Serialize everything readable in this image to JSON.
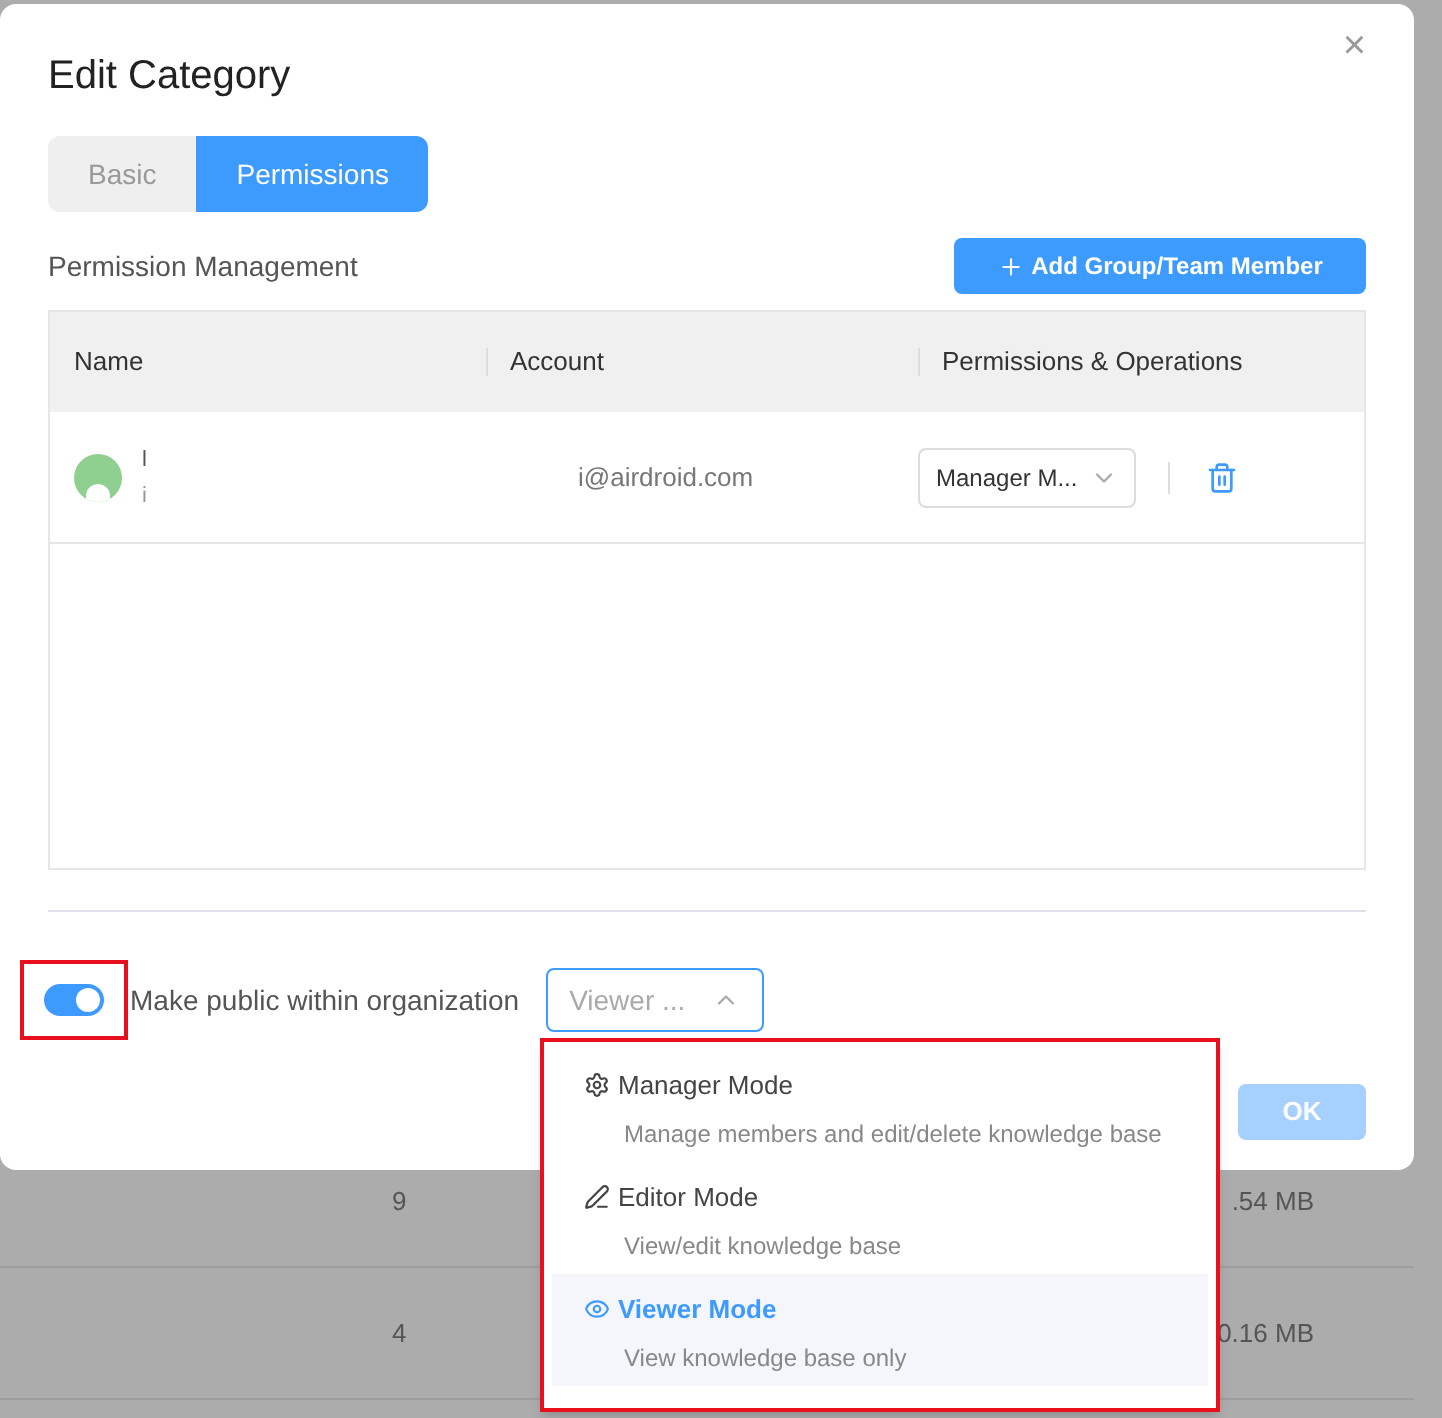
{
  "background_rows": [
    {
      "count": "9",
      "size": ".54 MB"
    },
    {
      "count": "4",
      "size": "0.16 MB"
    }
  ],
  "dialog": {
    "title": "Edit Category",
    "close": "×"
  },
  "tabs": [
    {
      "label": "Basic",
      "selected": false
    },
    {
      "label": "Permissions",
      "selected": true
    }
  ],
  "section_title": "Permission Management",
  "add_button": "Add Group/Team Member",
  "table": {
    "columns": [
      "Name",
      "Account",
      "Permissions & Operations"
    ],
    "rows": [
      {
        "name": "l",
        "subtitle": "i",
        "account": "i@airdroid.com",
        "permission": "Manager M..."
      }
    ]
  },
  "public_toggle": {
    "on": true,
    "label": "Make public within organization",
    "highlighted": true
  },
  "mode_select": {
    "value": "Viewer ...",
    "expanded": true
  },
  "ok_button": {
    "label": "OK",
    "disabled": true
  },
  "mode_menu": {
    "highlighted": true,
    "items": [
      {
        "kind": "gear",
        "title": "Manager Mode",
        "description": "Manage members and edit/delete knowledge base",
        "selected": false
      },
      {
        "kind": "pencil",
        "title": "Editor Mode",
        "description": "View/edit knowledge base",
        "selected": false
      },
      {
        "kind": "eye",
        "title": "Viewer Mode",
        "description": "View knowledge base only",
        "selected": true
      }
    ]
  }
}
